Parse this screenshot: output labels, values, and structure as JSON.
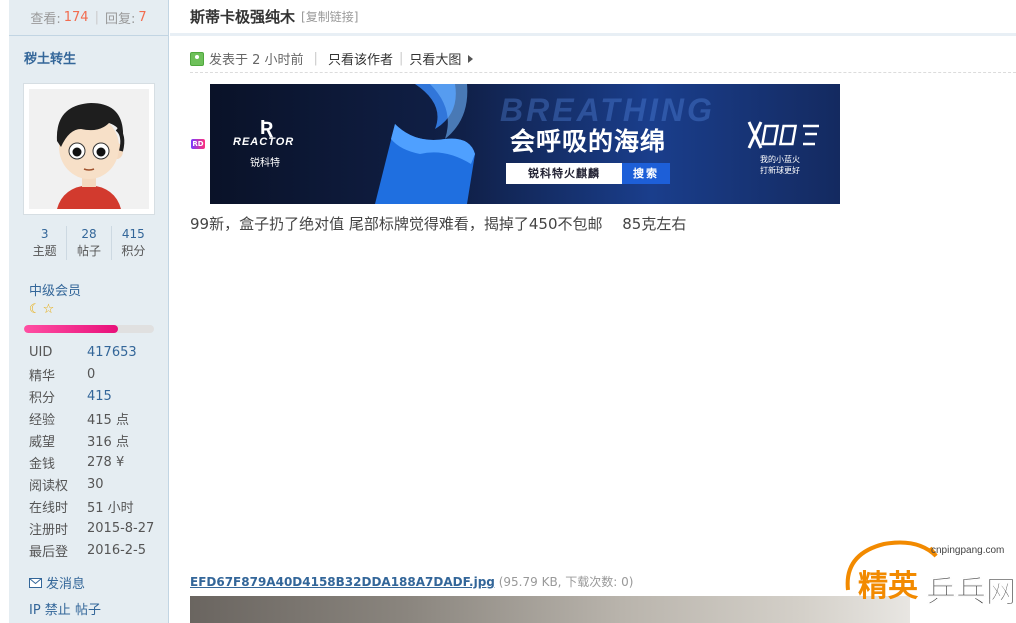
{
  "stats": {
    "views_label": "查看:",
    "views": "174",
    "replies_label": "回复:",
    "replies": "7"
  },
  "thread": {
    "title": "斯蒂卡极强纯木",
    "copy_link": "[复制链接]"
  },
  "author": {
    "name": "秽土转生",
    "counts": [
      {
        "num": "3",
        "label": "主题"
      },
      {
        "num": "28",
        "label": "帖子"
      },
      {
        "num": "415",
        "label": "积分"
      }
    ],
    "group": "中级会员",
    "level_icons": [
      "moon-icon",
      "star-icon"
    ],
    "progress": 0.72,
    "info": [
      {
        "k": "UID",
        "v": "417653",
        "link": true
      },
      {
        "k": "精华",
        "v": "0",
        "link": false
      },
      {
        "k": "积分",
        "v": "415",
        "link": true
      },
      {
        "k": "经验",
        "v": "415 点",
        "link": false
      },
      {
        "k": "威望",
        "v": "316 点",
        "link": false
      },
      {
        "k": "金钱",
        "v": "278 ¥",
        "link": false
      },
      {
        "k": "阅读权",
        "v": "30",
        "link": false
      },
      {
        "k": "在线时",
        "v": "51 小时",
        "link": false
      },
      {
        "k": "注册时",
        "v": "2015-8-27",
        "link": false
      },
      {
        "k": "最后登",
        "v": "2016-2-5",
        "link": false
      }
    ],
    "send_message": "发消息",
    "ban_links": "IP 禁止 帖子"
  },
  "post": {
    "posted": "发表于 2 小时前",
    "only_author": "只看该作者",
    "only_images": "只看大图",
    "body": "99新，盒子扔了绝对值 尾部标牌觉得难看，揭掉了450不包邮　 85克左右",
    "attachment": {
      "name": "EFD67F879A40D4158B32DDA188A7DADF.jpg",
      "meta": "(95.79 KB, 下载次数: 0)"
    }
  },
  "ad": {
    "badge": "RD",
    "brand_en": "REACTOR",
    "brand_cn": "锐科特",
    "bg_word": "BREATHING",
    "slogan": "会呼吸的海绵",
    "search_text": "锐科特火麒麟",
    "search_button": "搜索",
    "right_sub1": "我的小蓝火",
    "right_sub2": "打新球更好"
  },
  "watermark": {
    "site": "cnpingpang.com",
    "colors": {
      "orange": "#f28a00",
      "dark": "#333333"
    }
  },
  "colors": {
    "link": "#336699",
    "accent": "#f26c4f",
    "sidebar_bg": "#e5edf2"
  }
}
